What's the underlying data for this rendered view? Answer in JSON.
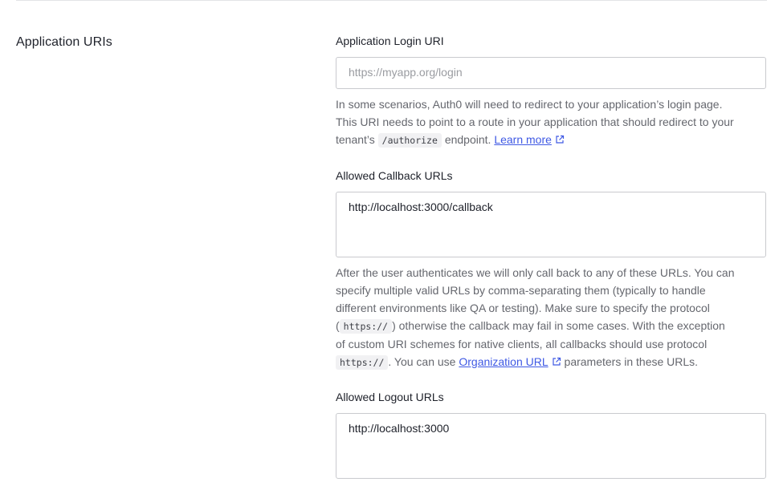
{
  "section": {
    "title": "Application URIs"
  },
  "login_uri": {
    "label": "Application Login URI",
    "value": "",
    "placeholder": "https://myapp.org/login",
    "help": {
      "line1": "In some scenarios, Auth0 will need to redirect to your application’s login page.",
      "line2": "This URI needs to point to a route in your application that should redirect to your",
      "line3_pre": "tenant’s",
      "line3_code": "/authorize",
      "line3_post": "endpoint.",
      "link": "Learn more",
      "link_icon": "external-link-icon"
    }
  },
  "callback_urls": {
    "label": "Allowed Callback URLs",
    "value": "http://localhost:3000/callback",
    "help": {
      "line1": "After the user authenticates we will only call back to any of these URLs. You can",
      "line2": "specify multiple valid URLs by comma-separating them (typically to handle",
      "line3": "different environments like QA or testing). Make sure to specify the protocol",
      "line4_pre": "(",
      "line4_code": "https://",
      "line4_post": ") otherwise the callback may fail in some cases. With the exception",
      "line5": "of custom URI schemes for native clients, all callbacks should use protocol",
      "line6_code": "https://",
      "line6_mid": ". You can use",
      "line6_link": "Organization URL",
      "line6_post": "parameters in these URLs.",
      "link_icon": "external-link-icon"
    }
  },
  "logout_urls": {
    "label": "Allowed Logout URLs",
    "value": "http://localhost:3000"
  },
  "colors": {
    "link": "#3f59e4",
    "help_text": "#65676e",
    "border": "#c9cace"
  }
}
